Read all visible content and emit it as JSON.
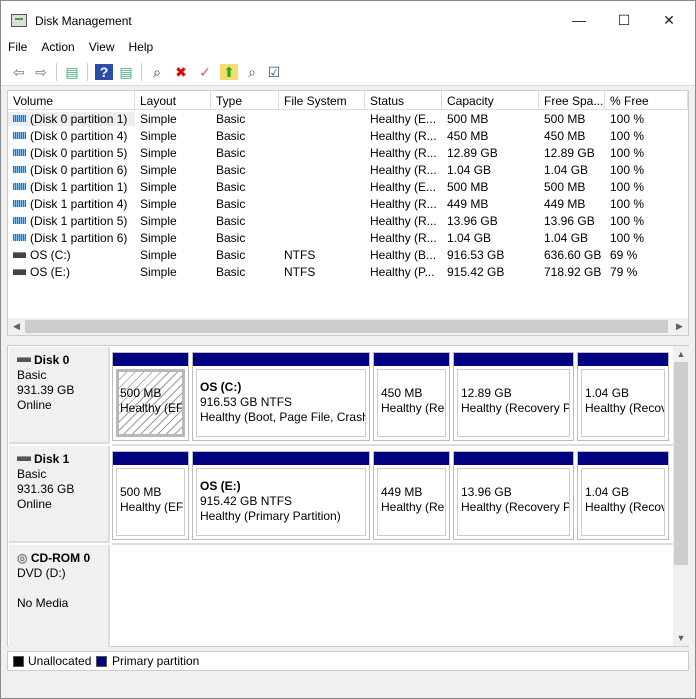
{
  "window": {
    "title": "Disk Management",
    "minimize": "—",
    "maximize": "☐",
    "close": "✕"
  },
  "menu": [
    "File",
    "Action",
    "View",
    "Help"
  ],
  "toolbar": [
    {
      "name": "back-icon",
      "glyph": "⇦",
      "color": "#777"
    },
    {
      "name": "forward-icon",
      "glyph": "⇨",
      "color": "#777"
    },
    {
      "name": "show-hide-console-tree-icon",
      "glyph": "▤",
      "color": "#4a7"
    },
    {
      "name": "help-icon",
      "glyph": "?",
      "color": "#fff"
    },
    {
      "name": "show-hide-action-pane-icon",
      "glyph": "▤",
      "color": "#4a7"
    },
    {
      "name": "connect-virtual-disk-icon",
      "glyph": "⌕",
      "color": "#333"
    },
    {
      "name": "delete-icon",
      "glyph": "✖",
      "color": "#d00"
    },
    {
      "name": "properties-icon",
      "glyph": "✓",
      "color": "#e55"
    },
    {
      "name": "open-folder-icon",
      "glyph": "⬆",
      "color": "#2a2"
    },
    {
      "name": "explore-icon",
      "glyph": "⌕",
      "color": "#555"
    },
    {
      "name": "settings-list-icon",
      "glyph": "☑",
      "color": "#357"
    }
  ],
  "columns": [
    "Volume",
    "Layout",
    "Type",
    "File System",
    "Status",
    "Capacity",
    "Free Spa...",
    "% Free"
  ],
  "volumes": [
    [
      "(Disk 0 partition 1)",
      "Simple",
      "Basic",
      "",
      "Healthy (E...",
      "500 MB",
      "500 MB",
      "100 %"
    ],
    [
      "(Disk 0 partition 4)",
      "Simple",
      "Basic",
      "",
      "Healthy (R...",
      "450 MB",
      "450 MB",
      "100 %"
    ],
    [
      "(Disk 0 partition 5)",
      "Simple",
      "Basic",
      "",
      "Healthy (R...",
      "12.89 GB",
      "12.89 GB",
      "100 %"
    ],
    [
      "(Disk 0 partition 6)",
      "Simple",
      "Basic",
      "",
      "Healthy (R...",
      "1.04 GB",
      "1.04 GB",
      "100 %"
    ],
    [
      "(Disk 1 partition 1)",
      "Simple",
      "Basic",
      "",
      "Healthy (E...",
      "500 MB",
      "500 MB",
      "100 %"
    ],
    [
      "(Disk 1 partition 4)",
      "Simple",
      "Basic",
      "",
      "Healthy (R...",
      "449 MB",
      "449 MB",
      "100 %"
    ],
    [
      "(Disk 1 partition 5)",
      "Simple",
      "Basic",
      "",
      "Healthy (R...",
      "13.96 GB",
      "13.96 GB",
      "100 %"
    ],
    [
      "(Disk 1 partition 6)",
      "Simple",
      "Basic",
      "",
      "Healthy (R...",
      "1.04 GB",
      "1.04 GB",
      "100 %"
    ],
    [
      "OS (C:)",
      "Simple",
      "Basic",
      "NTFS",
      "Healthy (B...",
      "916.53 GB",
      "636.60 GB",
      "69 %"
    ],
    [
      "OS (E:)",
      "Simple",
      "Basic",
      "NTFS",
      "Healthy (P...",
      "915.42 GB",
      "718.92 GB",
      "79 %"
    ]
  ],
  "disks": [
    {
      "name": "Disk 0",
      "type": "Basic",
      "size": "931.39 GB",
      "state": "Online",
      "partitions": [
        {
          "title": "",
          "size": "500 MB",
          "status": "Healthy (EFI",
          "selected": true
        },
        {
          "title": "OS  (C:)",
          "size": "916.53 GB NTFS",
          "status": "Healthy (Boot, Page File, Crash"
        },
        {
          "title": "",
          "size": "450 MB",
          "status": "Healthy (Rec"
        },
        {
          "title": "",
          "size": "12.89 GB",
          "status": "Healthy (Recovery Pa"
        },
        {
          "title": "",
          "size": "1.04 GB",
          "status": "Healthy (Recov"
        }
      ]
    },
    {
      "name": "Disk 1",
      "type": "Basic",
      "size": "931.36 GB",
      "state": "Online",
      "partitions": [
        {
          "title": "",
          "size": "500 MB",
          "status": "Healthy (EFI"
        },
        {
          "title": "OS  (E:)",
          "size": "915.42 GB NTFS",
          "status": "Healthy (Primary Partition)"
        },
        {
          "title": "",
          "size": "449 MB",
          "status": "Healthy (Rec"
        },
        {
          "title": "",
          "size": "13.96 GB",
          "status": "Healthy (Recovery Pa"
        },
        {
          "title": "",
          "size": "1.04 GB",
          "status": "Healthy (Recov"
        }
      ]
    }
  ],
  "cdrom": {
    "name": "CD-ROM 0",
    "drive": "DVD (D:)",
    "media": "No Media"
  },
  "legend": [
    {
      "label": "Unallocated",
      "color": "#000000"
    },
    {
      "label": "Primary partition",
      "color": "#000080"
    }
  ]
}
